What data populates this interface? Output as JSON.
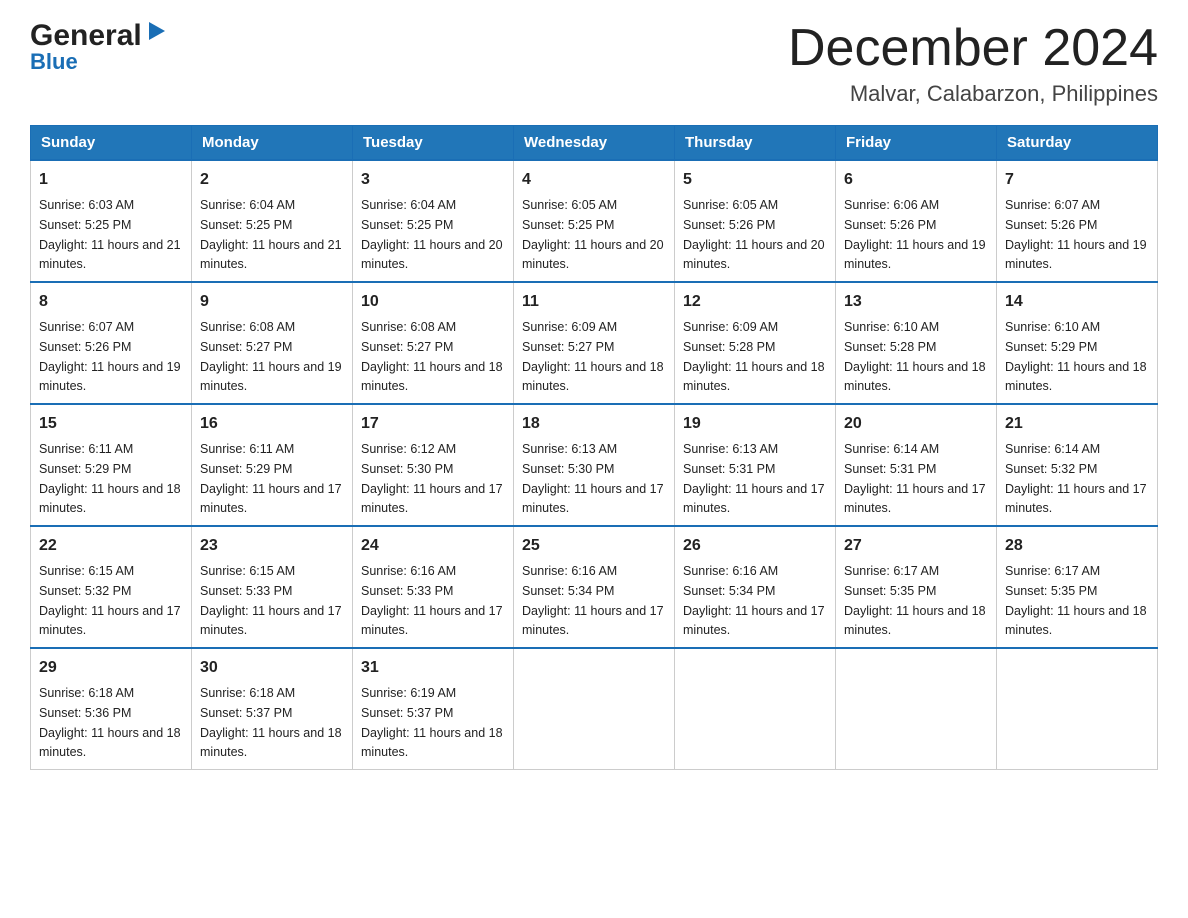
{
  "logo": {
    "general": "General",
    "blue": "Blue",
    "arrow": "▶"
  },
  "title": {
    "month": "December 2024",
    "location": "Malvar, Calabarzon, Philippines"
  },
  "weekdays": [
    "Sunday",
    "Monday",
    "Tuesday",
    "Wednesday",
    "Thursday",
    "Friday",
    "Saturday"
  ],
  "weeks": [
    [
      {
        "day": "1",
        "sunrise": "6:03 AM",
        "sunset": "5:25 PM",
        "daylight": "11 hours and 21 minutes."
      },
      {
        "day": "2",
        "sunrise": "6:04 AM",
        "sunset": "5:25 PM",
        "daylight": "11 hours and 21 minutes."
      },
      {
        "day": "3",
        "sunrise": "6:04 AM",
        "sunset": "5:25 PM",
        "daylight": "11 hours and 20 minutes."
      },
      {
        "day": "4",
        "sunrise": "6:05 AM",
        "sunset": "5:25 PM",
        "daylight": "11 hours and 20 minutes."
      },
      {
        "day": "5",
        "sunrise": "6:05 AM",
        "sunset": "5:26 PM",
        "daylight": "11 hours and 20 minutes."
      },
      {
        "day": "6",
        "sunrise": "6:06 AM",
        "sunset": "5:26 PM",
        "daylight": "11 hours and 19 minutes."
      },
      {
        "day": "7",
        "sunrise": "6:07 AM",
        "sunset": "5:26 PM",
        "daylight": "11 hours and 19 minutes."
      }
    ],
    [
      {
        "day": "8",
        "sunrise": "6:07 AM",
        "sunset": "5:26 PM",
        "daylight": "11 hours and 19 minutes."
      },
      {
        "day": "9",
        "sunrise": "6:08 AM",
        "sunset": "5:27 PM",
        "daylight": "11 hours and 19 minutes."
      },
      {
        "day": "10",
        "sunrise": "6:08 AM",
        "sunset": "5:27 PM",
        "daylight": "11 hours and 18 minutes."
      },
      {
        "day": "11",
        "sunrise": "6:09 AM",
        "sunset": "5:27 PM",
        "daylight": "11 hours and 18 minutes."
      },
      {
        "day": "12",
        "sunrise": "6:09 AM",
        "sunset": "5:28 PM",
        "daylight": "11 hours and 18 minutes."
      },
      {
        "day": "13",
        "sunrise": "6:10 AM",
        "sunset": "5:28 PM",
        "daylight": "11 hours and 18 minutes."
      },
      {
        "day": "14",
        "sunrise": "6:10 AM",
        "sunset": "5:29 PM",
        "daylight": "11 hours and 18 minutes."
      }
    ],
    [
      {
        "day": "15",
        "sunrise": "6:11 AM",
        "sunset": "5:29 PM",
        "daylight": "11 hours and 18 minutes."
      },
      {
        "day": "16",
        "sunrise": "6:11 AM",
        "sunset": "5:29 PM",
        "daylight": "11 hours and 17 minutes."
      },
      {
        "day": "17",
        "sunrise": "6:12 AM",
        "sunset": "5:30 PM",
        "daylight": "11 hours and 17 minutes."
      },
      {
        "day": "18",
        "sunrise": "6:13 AM",
        "sunset": "5:30 PM",
        "daylight": "11 hours and 17 minutes."
      },
      {
        "day": "19",
        "sunrise": "6:13 AM",
        "sunset": "5:31 PM",
        "daylight": "11 hours and 17 minutes."
      },
      {
        "day": "20",
        "sunrise": "6:14 AM",
        "sunset": "5:31 PM",
        "daylight": "11 hours and 17 minutes."
      },
      {
        "day": "21",
        "sunrise": "6:14 AM",
        "sunset": "5:32 PM",
        "daylight": "11 hours and 17 minutes."
      }
    ],
    [
      {
        "day": "22",
        "sunrise": "6:15 AM",
        "sunset": "5:32 PM",
        "daylight": "11 hours and 17 minutes."
      },
      {
        "day": "23",
        "sunrise": "6:15 AM",
        "sunset": "5:33 PM",
        "daylight": "11 hours and 17 minutes."
      },
      {
        "day": "24",
        "sunrise": "6:16 AM",
        "sunset": "5:33 PM",
        "daylight": "11 hours and 17 minutes."
      },
      {
        "day": "25",
        "sunrise": "6:16 AM",
        "sunset": "5:34 PM",
        "daylight": "11 hours and 17 minutes."
      },
      {
        "day": "26",
        "sunrise": "6:16 AM",
        "sunset": "5:34 PM",
        "daylight": "11 hours and 17 minutes."
      },
      {
        "day": "27",
        "sunrise": "6:17 AM",
        "sunset": "5:35 PM",
        "daylight": "11 hours and 18 minutes."
      },
      {
        "day": "28",
        "sunrise": "6:17 AM",
        "sunset": "5:35 PM",
        "daylight": "11 hours and 18 minutes."
      }
    ],
    [
      {
        "day": "29",
        "sunrise": "6:18 AM",
        "sunset": "5:36 PM",
        "daylight": "11 hours and 18 minutes."
      },
      {
        "day": "30",
        "sunrise": "6:18 AM",
        "sunset": "5:37 PM",
        "daylight": "11 hours and 18 minutes."
      },
      {
        "day": "31",
        "sunrise": "6:19 AM",
        "sunset": "5:37 PM",
        "daylight": "11 hours and 18 minutes."
      },
      null,
      null,
      null,
      null
    ]
  ],
  "labels": {
    "sunrise": "Sunrise:",
    "sunset": "Sunset:",
    "daylight": "Daylight:"
  }
}
